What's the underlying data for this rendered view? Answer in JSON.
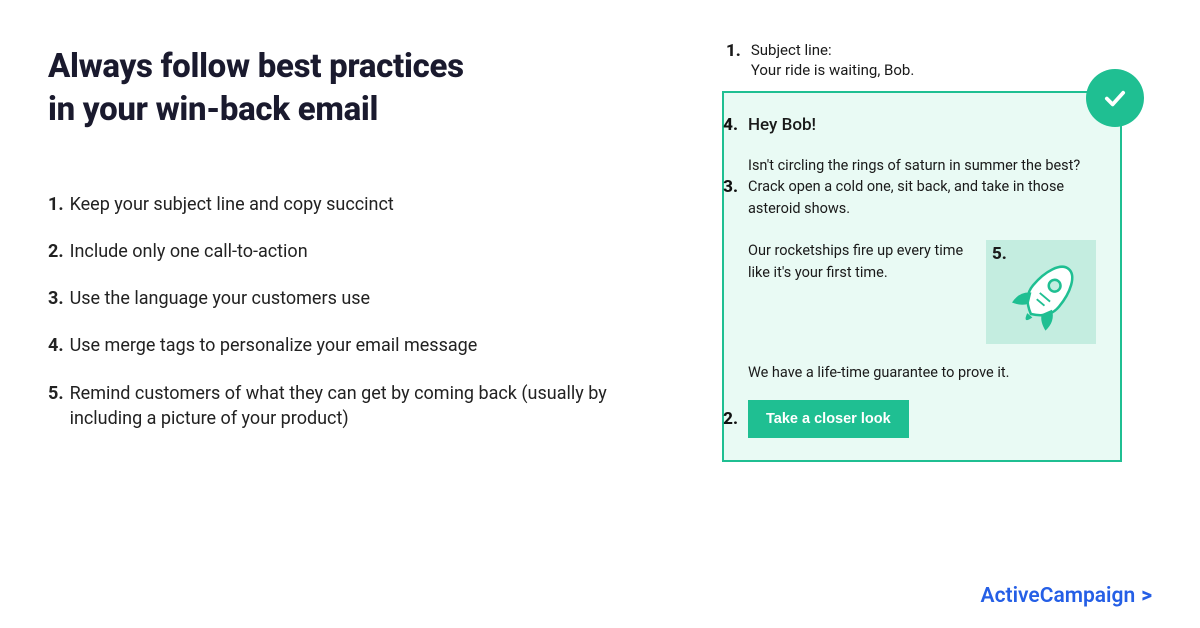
{
  "heading_line1": "Always follow best practices",
  "heading_line2": "in your win-back email",
  "practices": [
    {
      "num": "1.",
      "text": "Keep your subject line and copy succinct"
    },
    {
      "num": "2.",
      "text": "Include only one call-to-action"
    },
    {
      "num": "3.",
      "text": "Use the language your customers use"
    },
    {
      "num": "4.",
      "text": "Use merge tags to personalize your email message"
    },
    {
      "num": "5.",
      "text": " Remind customers of what they can get by coming back (usually by including a picture of your product)"
    }
  ],
  "example": {
    "subject_num": "1.",
    "subject_label": "Subject line:",
    "subject_value": "Your ride is waiting, Bob.",
    "greeting_num": "4.",
    "greeting": "Hey Bob!",
    "para1_num": "3.",
    "para1": "Isn't circling the rings of saturn in summer the best? Crack open a cold one, sit back, and take in those asteroid shows.",
    "para2": "Our rocketships fire up every time like it's your first time.",
    "img_num": "5.",
    "para3": "We have a life-time guarantee to prove it.",
    "cta_num": "2.",
    "cta_label": "Take a closer look"
  },
  "brand": {
    "name": "ActiveCampaign",
    "chevron": ">"
  }
}
